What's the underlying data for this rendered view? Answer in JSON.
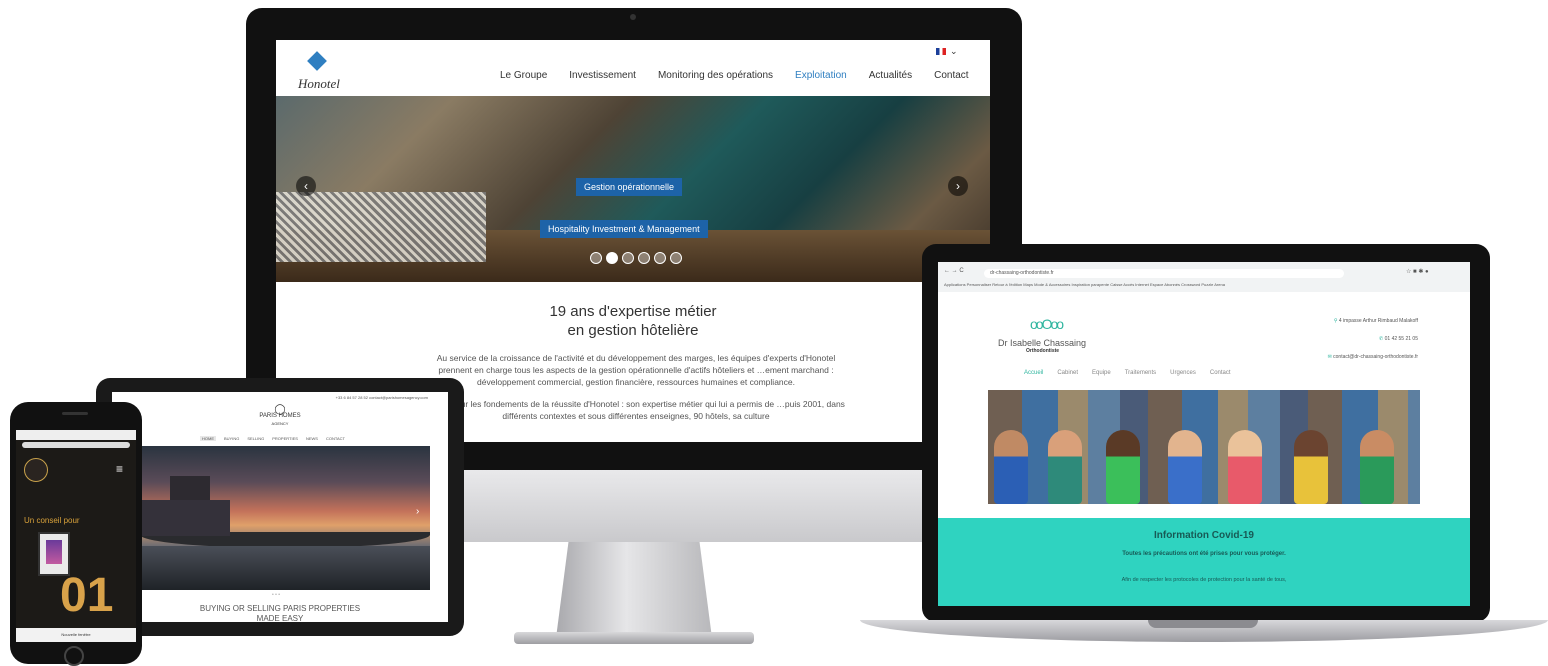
{
  "imac": {
    "lang": "",
    "logo": "Honotel",
    "nav": [
      "Le Groupe",
      "Investissement",
      "Monitoring des opérations",
      "Exploitation",
      "Actualités",
      "Contact"
    ],
    "nav_active": "Exploitation",
    "hero_badge_1": "Gestion opérationnelle",
    "hero_badge_2": "Hospitality Investment & Management",
    "prev_arrow": "‹",
    "next_arrow": "›",
    "title_line1": "19 ans d'expertise métier",
    "title_line2": "en gestion hôtelière",
    "paragraph_1": "Au service de la croissance de l'activité et du développement des marges, les équipes d'experts d'Honotel prennent en charge tous les aspects de la gestion opérationnelle d'actifs hôteliers et …ement marchand : développement commercial, gestion financière, ressources humaines et compliance.",
    "paragraph_2": "…pose sur les fondements de la réussite d'Honotel : son expertise métier qui lui a permis de …puis 2001, dans différents contextes et sous différentes enseignes, 90 hôtels, sa culture"
  },
  "tablet": {
    "topbar": "+33 6 84 57 28 52   contact@parishomesagency.com",
    "logo_line1": "PARIS HOMES",
    "logo_line2": "AGENCY",
    "nav": [
      "HOME",
      "BUYING",
      "SELLING",
      "PROPERTIES",
      "NEWS",
      "CONTACT"
    ],
    "nav_active": "HOME",
    "next_arrow": "›",
    "dots": "• • •",
    "caption_line1": "BUYING OR SELLING PARIS PROPERTIES",
    "caption_line2": "MADE EASY"
  },
  "phone": {
    "status": "",
    "menu_icon": "≡",
    "tagline": "Un conseil pour",
    "number": "01",
    "toolbar": "Nouvelle fenêtre"
  },
  "laptop": {
    "url": "dr-chassaing-orthodontiste.fr",
    "bookmarks": "Applications  Personnaliser  Retour à l'édition  Maps  Mode & Accessoires  Inspiration parapente  Caisse Accès Internet  Espace Abonnés  Crossword Puzzle Arena",
    "logo_mark": "ooOoo",
    "name": "Dr Isabelle Chassaing",
    "subtitle": "Orthodontiste",
    "contact_address": "4 impasse Arthur Rimbaud Malakoff",
    "contact_phone": "01 42 55 21 05",
    "contact_email": "contact@dr-chassaing-orthodontiste.fr",
    "nav": [
      "Accueil",
      "Cabinet",
      "Equipe",
      "Traitements",
      "Urgences",
      "Contact"
    ],
    "nav_active": "Accueil",
    "covid_title": "Information Covid-19",
    "covid_sub": "Toutes les précautions ont été prises pour vous protéger.",
    "covid_text": "Afin de respecter les protocoles de protection pour la santé de tous,"
  },
  "colors": {
    "honotel_blue": "#1d63a8",
    "teal": "#2fd3c0",
    "gold": "#d8a24a"
  }
}
